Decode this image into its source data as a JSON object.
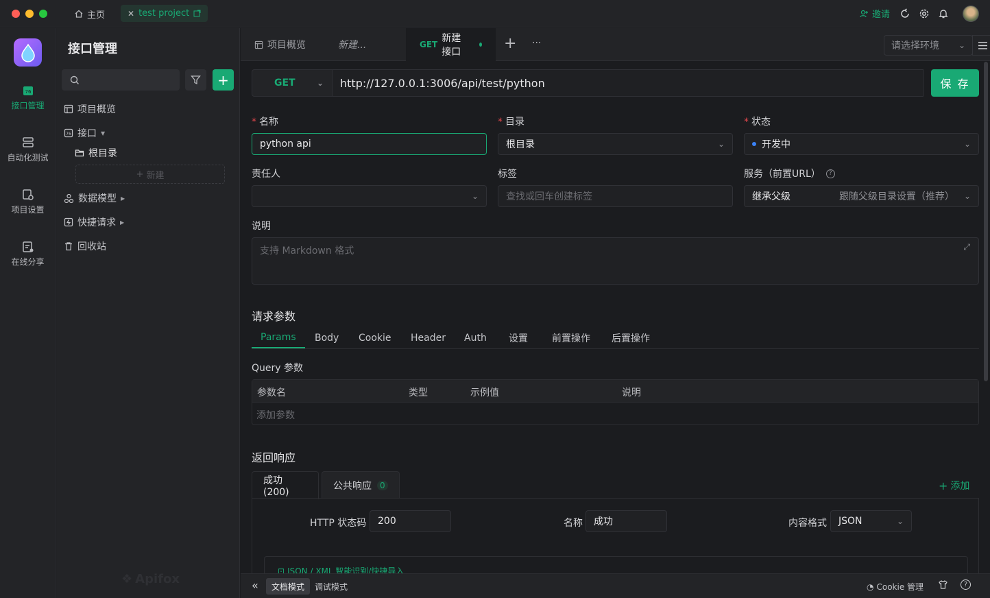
{
  "titlebar": {
    "home_label": "主页",
    "project_label": "test project",
    "invite_label": "邀请"
  },
  "rail": {
    "items": [
      {
        "label": "接口管理",
        "icon": "api-icon"
      },
      {
        "label": "自动化测试",
        "icon": "automation-icon"
      },
      {
        "label": "项目设置",
        "icon": "project-settings-icon"
      },
      {
        "label": "在线分享",
        "icon": "share-icon"
      }
    ]
  },
  "sidebar": {
    "title": "接口管理",
    "tree": {
      "overview": "项目概览",
      "api": "接口",
      "root_dir": "根目录",
      "new": "新建",
      "data_model": "数据模型",
      "quick_request": "快捷请求",
      "recycle": "回收站"
    },
    "watermark": "Apifox"
  },
  "tabs": {
    "overview": "项目概览",
    "new_draft": "新建...",
    "active_method": "GET",
    "active_label": "新建接口",
    "more": "···",
    "env_placeholder": "请选择环境"
  },
  "request": {
    "method": "GET",
    "url": "http://127.0.0.1:3006/api/test/python",
    "save_label": "保 存"
  },
  "form": {
    "name_label": "名称",
    "name_value": "python api",
    "dir_label": "目录",
    "dir_value": "根目录",
    "status_label": "状态",
    "status_value": "开发中",
    "owner_label": "责任人",
    "tag_label": "标签",
    "tag_placeholder": "查找或回车创建标签",
    "service_label": "服务（前置URL）",
    "service_value": "继承父级",
    "service_hint": "跟随父级目录设置（推荐）",
    "desc_label": "说明",
    "desc_placeholder": "支持 Markdown 格式"
  },
  "params": {
    "section_title": "请求参数",
    "tabs": [
      "Params",
      "Body",
      "Cookie",
      "Header",
      "Auth",
      "设置",
      "前置操作",
      "后置操作"
    ],
    "query_title": "Query 参数",
    "columns": [
      "参数名",
      "类型",
      "示例值",
      "说明"
    ],
    "add_placeholder": "添加参数"
  },
  "response": {
    "section_title": "返回响应",
    "tab_success": "成功(200)",
    "tab_common": "公共响应",
    "tab_common_count": "0",
    "add_label": "添加",
    "status_code_label": "HTTP 状态码",
    "status_code_value": "200",
    "name_label": "名称",
    "name_value": "成功",
    "format_label": "内容格式",
    "format_value": "JSON",
    "smart_import": "JSON / XML 智能识别/快捷导入"
  },
  "bottombar": {
    "doc_mode": "文档模式",
    "debug_mode": "调试模式",
    "cookie_manage": "Cookie 管理"
  },
  "colors": {
    "accent": "#19a974",
    "background": "#1b1c1f",
    "panel": "#232427"
  }
}
